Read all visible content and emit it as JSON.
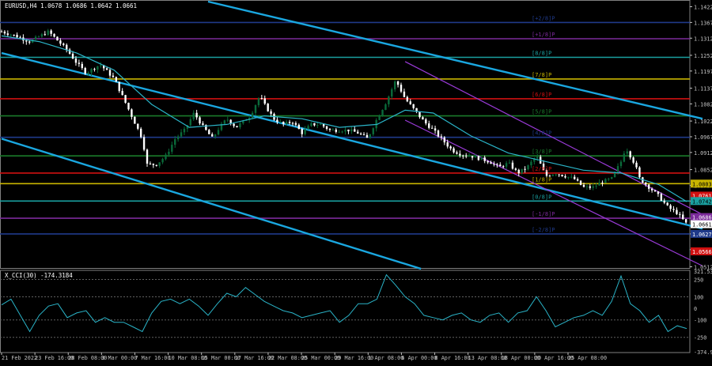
{
  "chart_data": [
    {
      "type": "candlestick",
      "panel": "price",
      "symbol_header": "EURUSD,H4 1.0678 1.0686 1.0642 1.0661",
      "series": [
        {
          "name": "EURUSD,H4",
          "close_path_approx": [
            [
              0,
              1.1335
            ],
            [
              1.5,
              1.132
            ],
            [
              3,
              1.13
            ],
            [
              5,
              1.1335
            ],
            [
              7,
              1.127
            ],
            [
              8,
              1.1225
            ],
            [
              9,
              1.119
            ],
            [
              10.5,
              1.122
            ],
            [
              12,
              1.117
            ],
            [
              13,
              1.11
            ],
            [
              14,
              1.103
            ],
            [
              15,
              1.096
            ],
            [
              15.5,
              1.087
            ],
            [
              16.5,
              1.087
            ],
            [
              17.5,
              1.09
            ],
            [
              18.5,
              1.096
            ],
            [
              19.5,
              1.099
            ],
            [
              20.5,
              1.105
            ],
            [
              21.5,
              1.1
            ],
            [
              22.5,
              1.096
            ],
            [
              23,
              1.099
            ],
            [
              24,
              1.103
            ],
            [
              25,
              1.1
            ],
            [
              26.5,
              1.104
            ],
            [
              27.5,
              1.111
            ],
            [
              28,
              1.108
            ],
            [
              29,
              1.103
            ],
            [
              30,
              1.101
            ],
            [
              31,
              1.102
            ],
            [
              32,
              1.098
            ],
            [
              33,
              1.101
            ],
            [
              34,
              1.101
            ],
            [
              35,
              1.099
            ],
            [
              36,
              1.099
            ],
            [
              37,
              1.099
            ],
            [
              38,
              1.098
            ],
            [
              39,
              1.096
            ],
            [
              40,
              1.103
            ],
            [
              41,
              1.109
            ],
            [
              42,
              1.1165
            ],
            [
              43,
              1.11
            ],
            [
              44,
              1.106
            ],
            [
              45,
              1.102
            ],
            [
              46,
              1.099
            ],
            [
              47,
              1.0955
            ],
            [
              48,
              1.092
            ],
            [
              49,
              1.0905
            ],
            [
              50,
              1.09
            ],
            [
              51,
              1.089
            ],
            [
              52,
              1.088
            ],
            [
              53,
              1.086
            ],
            [
              54,
              1.0875
            ],
            [
              55,
              1.084
            ],
            [
              56,
              1.086
            ],
            [
              57,
              1.09
            ],
            [
              58,
              1.083
            ],
            [
              59,
              1.084
            ],
            [
              60,
              1.083
            ],
            [
              61,
              1.082
            ],
            [
              62,
              1.079
            ],
            [
              63,
              1.079
            ],
            [
              64,
              1.081
            ],
            [
              65,
              1.082
            ],
            [
              66,
              1.088
            ],
            [
              66.5,
              1.093
            ],
            [
              67.5,
              1.087
            ],
            [
              68,
              1.082
            ],
            [
              69,
              1.079
            ],
            [
              70,
              1.076
            ],
            [
              71,
              1.072
            ],
            [
              72,
              1.07
            ],
            [
              73,
              1.0661
            ]
          ]
        },
        {
          "name": "MA",
          "path_approx": [
            [
              0,
              1.132
            ],
            [
              4,
              1.13
            ],
            [
              8,
              1.126
            ],
            [
              12,
              1.12
            ],
            [
              16,
              1.108
            ],
            [
              20,
              1.1
            ],
            [
              24,
              1.101
            ],
            [
              28,
              1.104
            ],
            [
              32,
              1.103
            ],
            [
              36,
              1.1
            ],
            [
              40,
              1.101
            ],
            [
              43,
              1.106
            ],
            [
              46,
              1.105
            ],
            [
              50,
              1.097
            ],
            [
              54,
              1.091
            ],
            [
              58,
              1.088
            ],
            [
              62,
              1.085
            ],
            [
              66,
              1.084
            ],
            [
              70,
              1.08
            ],
            [
              73,
              1.074
            ]
          ]
        }
      ],
      "price_ticks": [
        "1.1422",
        "1.1367",
        "1.1312",
        "1.1252",
        "1.1197",
        "1.1137",
        "1.1082",
        "1.1022",
        "1.0967",
        "1.0912",
        "1.0852",
        "1.0797",
        "1.0742",
        "1.0682",
        "1.0627",
        "1.0572",
        "1.0512"
      ],
      "price_ylim": [
        1.0505,
        1.144
      ],
      "x_labels": [
        "21 Feb 2022",
        "23 Feb 16:00",
        "28 Feb 08:00",
        "3 Mar 00:00",
        "7 Mar 16:00",
        "10 Mar 08:00",
        "15 Mar 00:00",
        "17 Mar 16:00",
        "22 Mar 08:00",
        "25 Mar 00:00",
        "29 Mar 16:00",
        "1 Apr 08:00",
        "6 Apr 00:00",
        "8 Apr 16:00",
        "13 Apr 08:00",
        "18 Apr 00:00",
        "20 Apr 16:00",
        "25 Apr 08:00"
      ],
      "murrey_levels": [
        {
          "label": "+2/8",
          "price": 1.1367,
          "color": "#1f3a8a"
        },
        {
          "label": "+1/8",
          "price": 1.131,
          "color": "#7b2a9a"
        },
        {
          "label": "8/8",
          "price": 1.1245,
          "color": "#1aa0a0"
        },
        {
          "label": "7/8",
          "price": 1.1169,
          "color": "#c8b400"
        },
        {
          "label": "6/8",
          "price": 1.11,
          "color": "#d01010"
        },
        {
          "label": "5/8",
          "price": 1.104,
          "color": "#1a7a2a"
        },
        {
          "label": "4/8",
          "price": 1.0965,
          "color": "#1f3a8a"
        },
        {
          "label": "3/8",
          "price": 1.09,
          "color": "#1a7a2a"
        },
        {
          "label": "2/8",
          "price": 1.084,
          "color": "#d01010"
        },
        {
          "label": "1/8",
          "price": 1.0803,
          "color": "#c8b400"
        },
        {
          "label": "0/8",
          "price": 1.0742,
          "color": "#1aa0a0"
        },
        {
          "label": "-1/8",
          "price": 1.0682,
          "color": "#7b2a9a"
        },
        {
          "label": "-2/8",
          "price": 1.0627,
          "color": "#1f3a8a"
        }
      ],
      "price_markers": [
        {
          "text": "1.0803",
          "price": 1.0803,
          "bg": "#c8b400",
          "fg": "#000000"
        },
        {
          "text": "1.0761",
          "price": 1.0761,
          "bg": "#d01010",
          "fg": "#ffffff"
        },
        {
          "text": "1.0742",
          "price": 1.0742,
          "bg": "#1aa0a0",
          "fg": "#000000"
        },
        {
          "text": "1.0686",
          "price": 1.0686,
          "bg": "#7b2a9a",
          "fg": "#ffffff"
        },
        {
          "text": "1.0661",
          "price": 1.0661,
          "bg": "#ffffff",
          "fg": "#000000"
        },
        {
          "text": "1.0627",
          "price": 1.0627,
          "bg": "#1f3a8a",
          "fg": "#ffffff"
        },
        {
          "text": "1.0566",
          "price": 1.0566,
          "bg": "#d01010",
          "fg": "#ffffff"
        }
      ],
      "channels": {
        "blue": {
          "color": "#1aa7e0",
          "lines": [
            {
              "x1": 22,
              "y1": 1.144,
              "x2": 73,
              "y2": 1.103
            },
            {
              "x1": 0,
              "y1": 1.126,
              "x2": 73,
              "y2": 1.0645
            },
            {
              "x1": 0,
              "y1": 1.096,
              "x2": 43,
              "y2": 1.0505
            }
          ]
        },
        "purple": {
          "color": "#9a3ad8",
          "lines": [
            {
              "x1": 43,
              "y1": 1.123,
              "x2": 73,
              "y2": 1.0695
            },
            {
              "x1": 43,
              "y1": 1.1025,
              "x2": 73,
              "y2": 1.0515
            }
          ]
        }
      }
    },
    {
      "type": "line",
      "panel": "indicator",
      "title": "X_CCI(30) -174.3184",
      "series": [
        {
          "name": "CCI",
          "path_approx": [
            [
              0,
              30
            ],
            [
              1,
              80
            ],
            [
              2,
              -60
            ],
            [
              3,
              -200
            ],
            [
              4,
              -60
            ],
            [
              5,
              20
            ],
            [
              6,
              40
            ],
            [
              7,
              -80
            ],
            [
              8,
              -40
            ],
            [
              9,
              -20
            ],
            [
              10,
              -120
            ],
            [
              11,
              -80
            ],
            [
              12,
              -120
            ],
            [
              13,
              -120
            ],
            [
              14,
              -160
            ],
            [
              15,
              -200
            ],
            [
              16,
              -40
            ],
            [
              17,
              60
            ],
            [
              18,
              80
            ],
            [
              19,
              40
            ],
            [
              20,
              80
            ],
            [
              21,
              20
            ],
            [
              22,
              -60
            ],
            [
              23,
              40
            ],
            [
              24,
              130
            ],
            [
              25,
              100
            ],
            [
              26,
              180
            ],
            [
              27,
              120
            ],
            [
              28,
              60
            ],
            [
              29,
              20
            ],
            [
              30,
              -20
            ],
            [
              31,
              -40
            ],
            [
              32,
              -80
            ],
            [
              33,
              -60
            ],
            [
              34,
              -40
            ],
            [
              35,
              -20
            ],
            [
              36,
              -120
            ],
            [
              37,
              -60
            ],
            [
              38,
              40
            ],
            [
              39,
              40
            ],
            [
              40,
              80
            ],
            [
              41,
              290
            ],
            [
              42,
              200
            ],
            [
              43,
              100
            ],
            [
              44,
              40
            ],
            [
              45,
              -60
            ],
            [
              46,
              -80
            ],
            [
              47,
              -100
            ],
            [
              48,
              -60
            ],
            [
              49,
              -40
            ],
            [
              50,
              -100
            ],
            [
              51,
              -120
            ],
            [
              52,
              -60
            ],
            [
              53,
              -40
            ],
            [
              54,
              -120
            ],
            [
              55,
              -40
            ],
            [
              56,
              -20
            ],
            [
              57,
              100
            ],
            [
              58,
              -20
            ],
            [
              59,
              -160
            ],
            [
              60,
              -120
            ],
            [
              61,
              -80
            ],
            [
              62,
              -60
            ],
            [
              63,
              -20
            ],
            [
              64,
              -60
            ],
            [
              65,
              60
            ],
            [
              66,
              280
            ],
            [
              67,
              40
            ],
            [
              68,
              -20
            ],
            [
              69,
              -120
            ],
            [
              70,
              -60
            ],
            [
              71,
              -200
            ],
            [
              72,
              -150
            ],
            [
              73,
              -174.32
            ]
          ]
        }
      ],
      "ticks": [
        "321.5307",
        "250",
        "100",
        "0",
        "-100",
        "-250",
        "-374.970"
      ],
      "ylim": [
        -374.97,
        321.5307
      ],
      "level_lines": [
        250,
        100,
        -100,
        -250
      ]
    }
  ],
  "colors": {
    "background": "#000000",
    "axis": "#c0c0c0",
    "text": "#ffffff",
    "bull": "#0a6a3a",
    "bear": "#ffffff",
    "ma": "#2ab4c8",
    "cci": "#2ab4c8"
  }
}
